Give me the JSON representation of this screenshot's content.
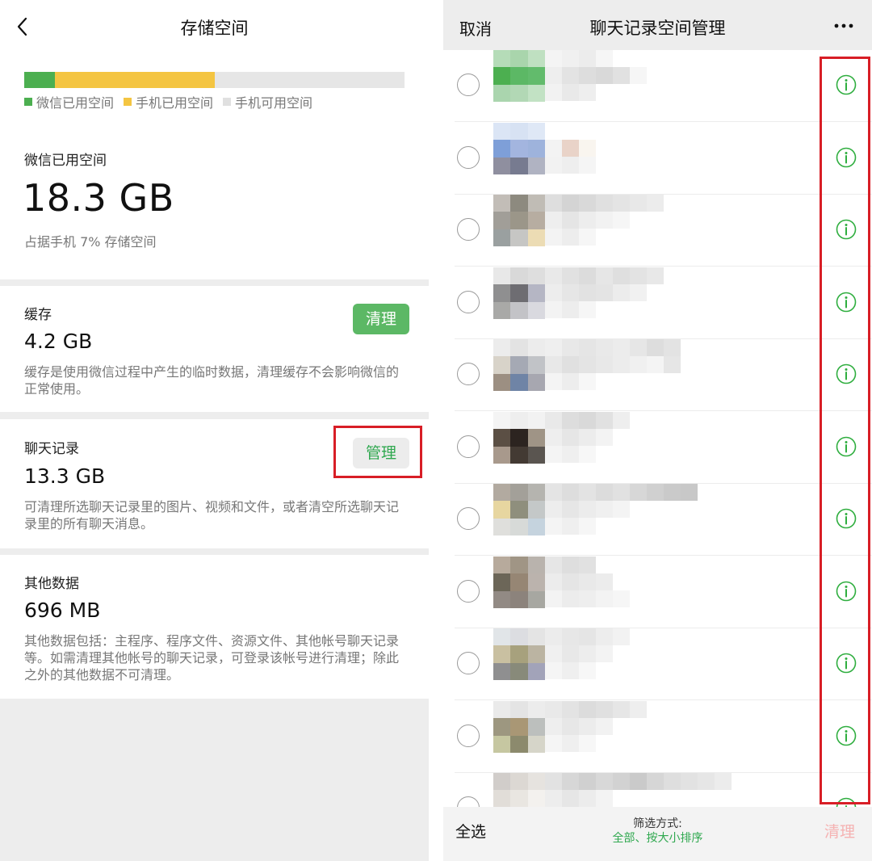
{
  "left": {
    "nav": {
      "title": "存储空间",
      "back_icon": "chevron-left-icon"
    },
    "usage": {
      "wechat_fraction": 0.08,
      "phone_fraction": 0.42,
      "colors": {
        "wechat": "#4caf50",
        "phone": "#f4c542",
        "free": "#e6e6e6"
      },
      "legend": [
        {
          "label": "微信已用空间",
          "color": "#4caf50"
        },
        {
          "label": "手机已用空间",
          "color": "#f4c542"
        },
        {
          "label": "手机可用空间",
          "color": "#e0e0e0"
        }
      ],
      "used_label": "微信已用空间",
      "used_value": "18.3 GB",
      "used_note": "占据手机 7% 存储空间"
    },
    "cache": {
      "title": "缓存",
      "value": "4.2 GB",
      "button": "清理",
      "desc": "缓存是使用微信过程中产生的临时数据，清理缓存不会影响微信的正常使用。"
    },
    "chat": {
      "title": "聊天记录",
      "value": "13.3 GB",
      "button": "管理",
      "desc": "可清理所选聊天记录里的图片、视频和文件，或者清空所选聊天记录里的所有聊天消息。"
    },
    "other": {
      "title": "其他数据",
      "value": "696 MB",
      "desc": "其他数据包括：主程序、程序文件、资源文件、其他帐号聊天记录等。如需清理其他帐号的聊天记录，可登录该帐号进行清理；除此之外的其他数据不可清理。"
    }
  },
  "right": {
    "nav": {
      "cancel": "取消",
      "title": "聊天记录空间管理",
      "more_icon": "more-dots-icon"
    },
    "rows": [
      {
        "avatar": [
          "#b5dcb8",
          "#a9d5ac",
          "#bfe0c1",
          "#4caf50",
          "#5cb865",
          "#62bb6c",
          "#aad5ae",
          "#b2d8b5",
          "#c2e2c4"
        ],
        "blur": [
          [
            "#f4f4f4",
            "#f0f0f0",
            "#ececec",
            "#f6f6f6"
          ],
          [
            "#eeeeee",
            "#e3e3e3",
            "#dddddd",
            "#d9d9d9",
            "#e1e1e1",
            "#f6f6f6"
          ],
          [
            "#f2f2f2",
            "#e9e9e9",
            "#eeeeee"
          ]
        ]
      },
      {
        "avatar": [
          "#dbe5f5",
          "#d7e2f3",
          "#dfe8f6",
          "#7e9fd8",
          "#a3b5df",
          "#9eb3dc",
          "#8f8f9f",
          "#777b90",
          "#b0b3c2"
        ],
        "blur": [
          [
            "#ffffff",
            "#ffffff",
            "#ffffff",
            "#ffffff"
          ],
          [
            "#f3f3f3",
            "#e9d3c8",
            "#f9f5ef",
            "#ffffff"
          ],
          [
            "#f2f2f2",
            "#eeeeee",
            "#f5f5f5"
          ]
        ]
      },
      {
        "avatar": [
          "#c2bdb7",
          "#8d8a7f",
          "#c0bcb5",
          "#a19e98",
          "#9b9689",
          "#b7ada1",
          "#9aa0a0",
          "#c6c6c4",
          "#ecdcb4"
        ],
        "blur": [
          [
            "#dedede",
            "#d4d4d4",
            "#d9d9d9",
            "#e0e0e0",
            "#e4e4e4",
            "#e8e8e8",
            "#ececec"
          ],
          [
            "#eeeeee",
            "#e5e5e5",
            "#ededed",
            "#f2f2f2",
            "#f6f6f6"
          ],
          [
            "#f3f3f3",
            "#ededed",
            "#f6f6f6"
          ]
        ]
      },
      {
        "avatar": [
          "#e8e8e8",
          "#d9d9d9",
          "#dedede",
          "#8f8f90",
          "#6e6d72",
          "#b5b6c4",
          "#a9a9a7",
          "#c3c3c7",
          "#d9d9df"
        ],
        "blur": [
          [
            "#e9e9e9",
            "#e1e1e1",
            "#dcdcdc",
            "#e6e6e6",
            "#dfdfdf",
            "#e3e3e3",
            "#e8e8e8"
          ],
          [
            "#ededed",
            "#e6e6e6",
            "#e2e2e2",
            "#e4e4e4",
            "#ececec",
            "#f1f1f1"
          ],
          [
            "#f3f3f3",
            "#ededed",
            "#f6f6f6"
          ]
        ]
      },
      {
        "avatar": [
          "#ececec",
          "#e3e3e3",
          "#ececec",
          "#d8d3c9",
          "#a5a9b4",
          "#c1c3c7",
          "#9c8f82",
          "#6f84a6",
          "#a7a7b0"
        ],
        "blur": [
          [
            "#efefef",
            "#e8e8e8",
            "#e5e5e5",
            "#e9e9e9",
            "#ececec",
            "#e6e6e6",
            "#dddddd",
            "#e3e3e3"
          ],
          [
            "#e8e8e8",
            "#e0e0e0",
            "#e4e4e4",
            "#e8e8e8",
            "#ececec",
            "#f0f0f0",
            "#f4f4f4",
            "#e6e6e6"
          ],
          [
            "#f4f4f4",
            "#ededed",
            "#f7f7f7"
          ]
        ]
      },
      {
        "avatar": [
          "#f4f4f4",
          "#eeeeee",
          "#f2f2f2",
          "#5b4f44",
          "#2c2420",
          "#9f9486",
          "#a8998c",
          "#433a33",
          "#5a5550"
        ],
        "blur": [
          [
            "#e9e9e9",
            "#dddddd",
            "#d9d9d9",
            "#e1e1e1",
            "#eeeeee"
          ],
          [
            "#eeeeee",
            "#e6e6e6",
            "#ececec",
            "#f3f3f3"
          ],
          [
            "#f4f4f4",
            "#efefef",
            "#f7f7f7"
          ]
        ]
      },
      {
        "avatar": [
          "#b2aaa0",
          "#a3a099",
          "#b5b4af",
          "#e7d6a0",
          "#8f8f7d",
          "#c4c8c8",
          "#dfdfdc",
          "#d7dad8",
          "#c5d3de"
        ],
        "blur": [
          [
            "#e4e4e4",
            "#dddddd",
            "#e3e3e3",
            "#dcdcdc",
            "#e1e1e1",
            "#d7d7d7",
            "#d0d0d0",
            "#cacaca",
            "#c8c8c8"
          ],
          [
            "#ededed",
            "#e6e6e6",
            "#ececec",
            "#f0f0f0",
            "#f4f4f4"
          ],
          [
            "#f4f4f4",
            "#efefef",
            "#f6f6f6"
          ]
        ]
      },
      {
        "avatar": [
          "#b7aa9c",
          "#a09585",
          "#b9b3ad",
          "#6c6658",
          "#968674",
          "#bbb3ad",
          "#928a84",
          "#8c837c",
          "#a7a7a1"
        ],
        "blur": [
          [
            "#e6e6e6",
            "#dedede",
            "#e1e1e1"
          ],
          [
            "#ececec",
            "#e5e5e5",
            "#e9e9e9",
            "#ececec"
          ],
          [
            "#f3f3f3",
            "#ececec",
            "#eeeeee",
            "#f3f3f3",
            "#f6f6f6"
          ]
        ]
      },
      {
        "avatar": [
          "#e1e5e8",
          "#dcdde1",
          "#e4e4e4",
          "#c9c0a1",
          "#a7a17d",
          "#bbb4a2",
          "#8f8f90",
          "#888a7a",
          "#a2a3b9"
        ],
        "blur": [
          [
            "#ececec",
            "#e7e7e7",
            "#e5e5e5",
            "#ededed",
            "#f2f2f2"
          ],
          [
            "#f0f0f0",
            "#e8e8e8",
            "#ededed",
            "#f3f3f3"
          ],
          [
            "#f5f5f5",
            "#efefef",
            "#f7f7f7"
          ]
        ]
      },
      {
        "avatar": [
          "#eaeaea",
          "#e4e4e4",
          "#ececec",
          "#9d9780",
          "#a99775",
          "#bcbfbd",
          "#c6c7a1",
          "#8c8a6d",
          "#d6d5c9"
        ],
        "blur": [
          [
            "#e9e9e9",
            "#e3e3e3",
            "#dcdcdc",
            "#e0e0e0",
            "#e6e6e6",
            "#eeeeee"
          ],
          [
            "#eeeeee",
            "#e7e7e7",
            "#ececec",
            "#f2f2f2"
          ],
          [
            "#f5f5f5",
            "#efefef",
            "#f7f7f7"
          ]
        ]
      },
      {
        "avatar": [
          "#d1cdca",
          "#dcd8d3",
          "#e6e3df",
          "#e1ddd8",
          "#e9e6e1",
          "#f3f1ee",
          "#f7f7f7",
          "#f4f4f4",
          "#fafafa"
        ],
        "blur": [
          [
            "#e2e2e2",
            "#d7d7d7",
            "#d0d0d0",
            "#d8d8d8",
            "#d2d2d2",
            "#cacaca",
            "#d6d6d6",
            "#dedede",
            "#e2e2e2",
            "#e6e6e6",
            "#ececec"
          ],
          [
            "#ededed",
            "#e6e6e6",
            "#ececec",
            "#f3f3f3"
          ],
          [
            "#f6f6f6",
            "#f0f0f0",
            "#f7f7f7"
          ]
        ]
      }
    ],
    "info_icon": "info-circle-icon",
    "info_color": "#2fae3f",
    "bottom": {
      "select_all": "全选",
      "filter_label": "筛选方式:",
      "filter_value": "全部、按大小排序",
      "clean": "清理"
    },
    "highlight_color": "#d81e26"
  }
}
